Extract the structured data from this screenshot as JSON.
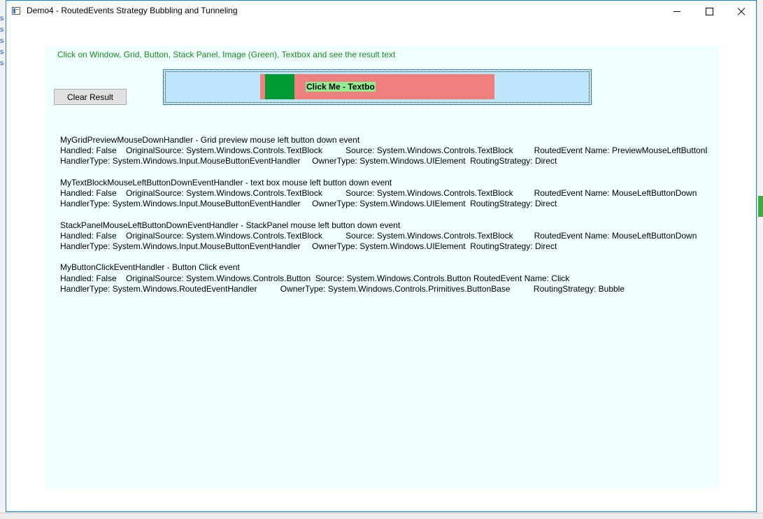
{
  "window": {
    "title": "Demo4 - RoutedEvents Strategy Bubbling and Tunneling"
  },
  "instruction": "Click on Window, Grid, Button, Stack Panel, Image (Green), Textbox and see the result text",
  "clear_button": "Clear Result",
  "main_button": {
    "textbox_text": "Click Me - Textbo"
  },
  "results": [
    {
      "header": "MyGridPreviewMouseDownHandler - Grid preview mouse left button down event",
      "line2": "Handled: False    OriginalSource: System.Windows.Controls.TextBlock          Source: System.Windows.Controls.TextBlock         RoutedEvent Name: PreviewMouseLeftButtonDown",
      "line3": "HandlerType: System.Windows.Input.MouseButtonEventHandler     OwnerType: System.Windows.UIElement  RoutingStrategy: Direct"
    },
    {
      "header": "MyTextBlockMouseLeftButtonDownEventHandler - text box mouse left button down event",
      "line2": "Handled: False    OriginalSource: System.Windows.Controls.TextBlock          Source: System.Windows.Controls.TextBlock         RoutedEvent Name: MouseLeftButtonDown",
      "line3": "HandlerType: System.Windows.Input.MouseButtonEventHandler     OwnerType: System.Windows.UIElement  RoutingStrategy: Direct"
    },
    {
      "header": "StackPanelMouseLeftButtonDownEventHandler - StackPanel mouse left button down event",
      "line2": "Handled: False    OriginalSource: System.Windows.Controls.TextBlock          Source: System.Windows.Controls.TextBlock         RoutedEvent Name: MouseLeftButtonDown",
      "line3": "HandlerType: System.Windows.Input.MouseButtonEventHandler     OwnerType: System.Windows.UIElement  RoutingStrategy: Direct"
    },
    {
      "header": "MyButtonClickEventHandler - Button Click event",
      "line2": "Handled: False    OriginalSource: System.Windows.Controls.Button  Source: System.Windows.Controls.Button RoutedEvent Name: Click",
      "line3": "HandlerType: System.Windows.RoutedEventHandler          OwnerType: System.Windows.Controls.Primitives.ButtonBase          RoutingStrategy: Bubble"
    }
  ]
}
